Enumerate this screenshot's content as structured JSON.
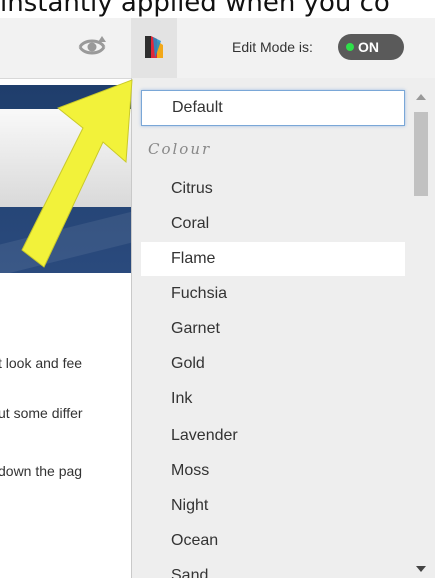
{
  "caption": "instantly applied when you co",
  "toolbar": {
    "preview_icon": "eye-refresh-icon",
    "palette_icon": "color-palette-icon",
    "edit_mode_label": "Edit Mode is:",
    "edit_mode_state": "ON",
    "toggle_dot_color": "#2ee04a"
  },
  "background_page": {
    "lines": [
      "t look and fee",
      "ut some differ",
      "down the pag"
    ]
  },
  "theme_menu": {
    "default_label": "Default",
    "section_heading": "Colour",
    "options": [
      "Citrus",
      "Coral",
      "Flame",
      "Fuchsia",
      "Garnet",
      "Gold",
      "Ink",
      "Lavender",
      "Moss",
      "Night",
      "Ocean",
      "Sand"
    ],
    "highlighted": "Flame"
  },
  "annotation": {
    "arrow_color": "#f2f23a"
  }
}
